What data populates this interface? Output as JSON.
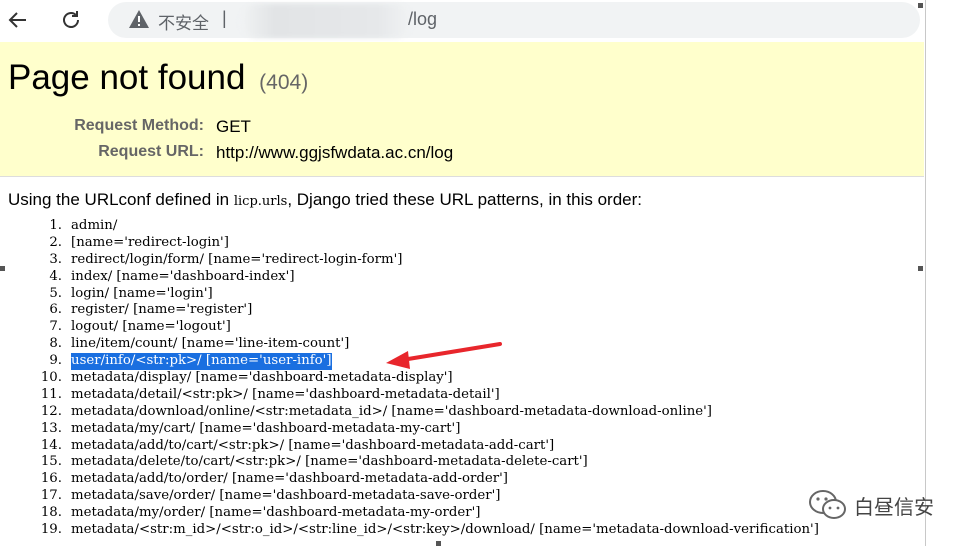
{
  "browser": {
    "insecure_label": "不安全",
    "separator": "|",
    "url_path": "/log"
  },
  "error": {
    "title": "Page not found",
    "code": "(404)",
    "method_label": "Request Method:",
    "method_value": "GET",
    "url_label": "Request URL:",
    "url_value": "http://www.ggjsfwdata.ac.cn/log"
  },
  "intro": {
    "before": "Using the URLconf defined in ",
    "module": "licp.urls",
    "after": ", Django tried these URL patterns, in this order:"
  },
  "patterns": [
    {
      "n": "1.",
      "text": "admin/"
    },
    {
      "n": "2.",
      "text": "[name='redirect-login']"
    },
    {
      "n": "3.",
      "text": "redirect/login/form/ [name='redirect-login-form']"
    },
    {
      "n": "4.",
      "text": "index/ [name='dashboard-index']"
    },
    {
      "n": "5.",
      "text": "login/ [name='login']"
    },
    {
      "n": "6.",
      "text": "register/ [name='register']"
    },
    {
      "n": "7.",
      "text": "logout/ [name='logout']"
    },
    {
      "n": "8.",
      "text": "line/item/count/ [name='line-item-count']"
    },
    {
      "n": "9.",
      "text": "user/info/<str:pk>/ [name='user-info']"
    },
    {
      "n": "10.",
      "text": "metadata/display/ [name='dashboard-metadata-display']"
    },
    {
      "n": "11.",
      "text": "metadata/detail/<str:pk>/ [name='dashboard-metadata-detail']"
    },
    {
      "n": "12.",
      "text": "metadata/download/online/<str:metadata_id>/ [name='dashboard-metadata-download-online']"
    },
    {
      "n": "13.",
      "text": "metadata/my/cart/ [name='dashboard-metadata-my-cart']"
    },
    {
      "n": "14.",
      "text": "metadata/add/to/cart/<str:pk>/ [name='dashboard-metadata-add-cart']"
    },
    {
      "n": "15.",
      "text": "metadata/delete/to/cart/<str:pk>/ [name='dashboard-metadata-delete-cart']"
    },
    {
      "n": "16.",
      "text": "metadata/add/to/order/ [name='dashboard-metadata-add-order']"
    },
    {
      "n": "17.",
      "text": "metadata/save/order/ [name='dashboard-metadata-save-order']"
    },
    {
      "n": "18.",
      "text": "metadata/my/order/ [name='dashboard-metadata-my-order']"
    },
    {
      "n": "19.",
      "text": "metadata/<str:m_id>/<str:o_id>/<str:line_id>/<str:key>/download/ [name='metadata-download-verification']"
    }
  ],
  "watermark": {
    "text": "白昼信安",
    "icon": "wechat-icon"
  },
  "colors": {
    "highlight": "#1a6fe0",
    "arrow": "#e8262c",
    "summary_bg": "#ffffcc"
  }
}
